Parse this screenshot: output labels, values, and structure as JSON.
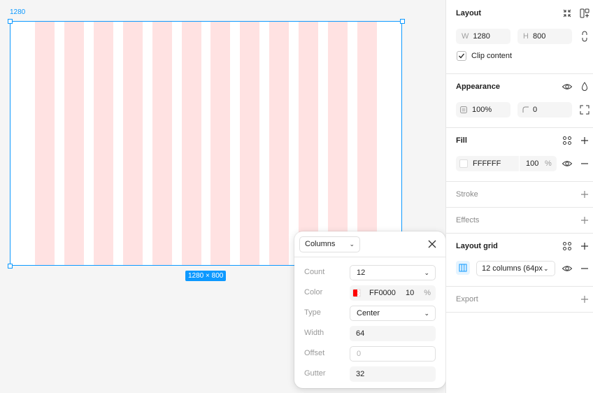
{
  "canvas": {
    "frame_label": "1280",
    "size_badge": "1280 × 800",
    "grid_color": "#ffe2e2"
  },
  "layout_grid_popover": {
    "type_select": "Columns",
    "rows": [
      {
        "label": "Count",
        "value": "12",
        "kind": "select"
      },
      {
        "label": "Color",
        "value": "FF0000",
        "opacity": "10",
        "unit": "%",
        "kind": "color"
      },
      {
        "label": "Type",
        "value": "Center",
        "kind": "select"
      },
      {
        "label": "Width",
        "value": "64",
        "kind": "input"
      },
      {
        "label": "Offset",
        "value": "",
        "placeholder": "0",
        "kind": "input"
      },
      {
        "label": "Gutter",
        "value": "32",
        "kind": "input"
      }
    ]
  },
  "panel": {
    "layout": {
      "title": "Layout",
      "w_label": "W",
      "w_value": "1280",
      "h_label": "H",
      "h_value": "800",
      "clip_label": "Clip content",
      "clip_checked": true
    },
    "appearance": {
      "title": "Appearance",
      "opacity": "100%",
      "radius": "0"
    },
    "fill": {
      "title": "Fill",
      "hex": "FFFFFF",
      "opacity": "100",
      "unit": "%"
    },
    "stroke": {
      "title": "Stroke"
    },
    "effects": {
      "title": "Effects"
    },
    "layout_grid": {
      "title": "Layout grid",
      "value": "12 columns (64px"
    },
    "export": {
      "title": "Export"
    }
  },
  "colors": {
    "accent": "#0d99ff",
    "grid_red": "#FF0000"
  }
}
